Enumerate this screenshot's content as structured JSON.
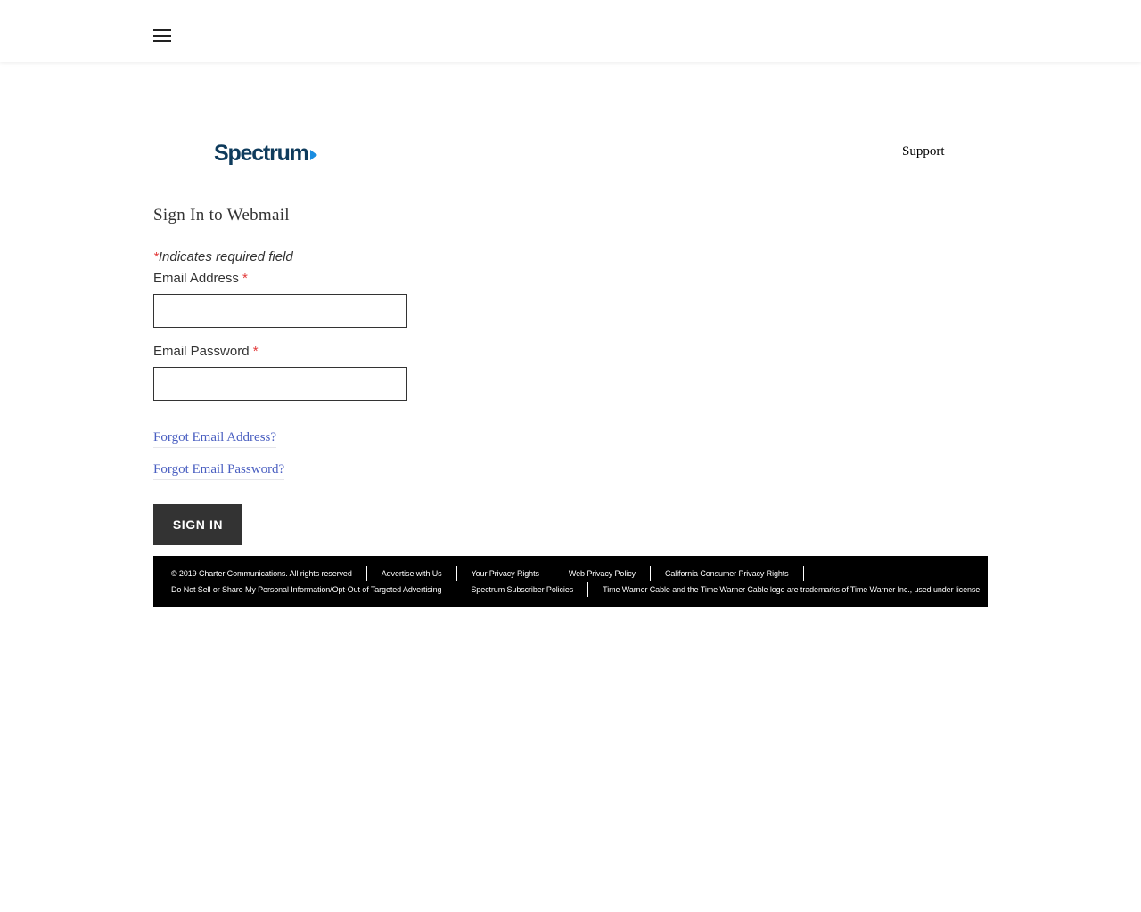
{
  "header": {
    "menu_icon": "hamburger-menu-icon"
  },
  "brand": {
    "logo_text": "Spectrum",
    "logo_color": "#0e3b5c",
    "arrow_color": "#1b8de0"
  },
  "nav": {
    "support_label": "Support"
  },
  "form": {
    "title": "Sign In to Webmail",
    "required_asterisk": "*",
    "required_note": "Indicates required field",
    "email_label": "Email Address",
    "email_value": "",
    "password_label": "Email Password",
    "password_value": "",
    "forgot_email_label": "Forgot Email Address?",
    "forgot_password_label": "Forgot Email Password?",
    "signin_label": "SIGN IN"
  },
  "footer": {
    "row1": [
      "© 2019 Charter Communications. All rights reserved",
      "Advertise with Us",
      "Your Privacy Rights",
      "Web Privacy Policy",
      "California Consumer Privacy Rights"
    ],
    "row2": [
      "Do Not Sell or Share My Personal Information/Opt-Out of Targeted Advertising",
      "Spectrum Subscriber Policies",
      "Time Warner Cable and the Time Warner Cable logo are trademarks of Time Warner Inc., used under license."
    ]
  },
  "colors": {
    "accent_link": "#4a5fc1",
    "required": "#e23a3a",
    "button_bg": "#333333",
    "footer_bg": "#000000"
  }
}
